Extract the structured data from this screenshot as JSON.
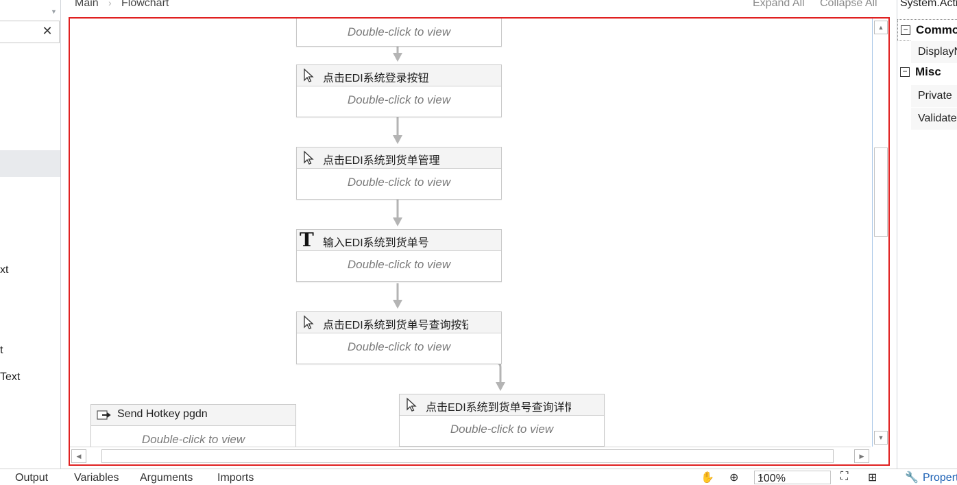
{
  "left_panel": {
    "items": [
      "xt",
      "t",
      "Text"
    ]
  },
  "breadcrumb": {
    "items": [
      "Main",
      "Flowchart"
    ],
    "expand_all": "Expand All",
    "collapse_all": "Collapse All"
  },
  "activities": [
    {
      "title": "",
      "hint": "Double-click to view",
      "icon": "cursor-icon"
    },
    {
      "title": "点击EDI系统登录按钮",
      "hint": "Double-click to view",
      "icon": "cursor-icon"
    },
    {
      "title": "点击EDI系统到货单管理",
      "hint": "Double-click to view",
      "icon": "cursor-icon"
    },
    {
      "title": "输入EDI系统到货单号",
      "hint": "Double-click to view",
      "icon": "type-text-icon"
    },
    {
      "title": "点击EDI系统到货单号查询按钮",
      "hint": "Double-click to view",
      "icon": "cursor-icon"
    },
    {
      "title": "点击EDI系统到货单号查询详情",
      "hint": "Double-click to view",
      "icon": "cursor-icon"
    },
    {
      "title": "Send Hotkey pgdn",
      "hint": "Double-click to view",
      "icon": "send-hotkey-icon"
    }
  ],
  "properties": {
    "title": "System.Activities",
    "categories": [
      {
        "label": "Common",
        "rows": [
          "DisplayName"
        ]
      },
      {
        "label": "Misc",
        "rows": [
          "Private",
          "Validate"
        ]
      }
    ]
  },
  "bottom_bar": {
    "left_tab": "Output",
    "tabs": [
      "Variables",
      "Arguments",
      "Imports"
    ],
    "zoom": "100%",
    "properties_tab": "Properties"
  },
  "colors": {
    "selection_border": "#e02020",
    "connector": "#b4b4b4"
  }
}
